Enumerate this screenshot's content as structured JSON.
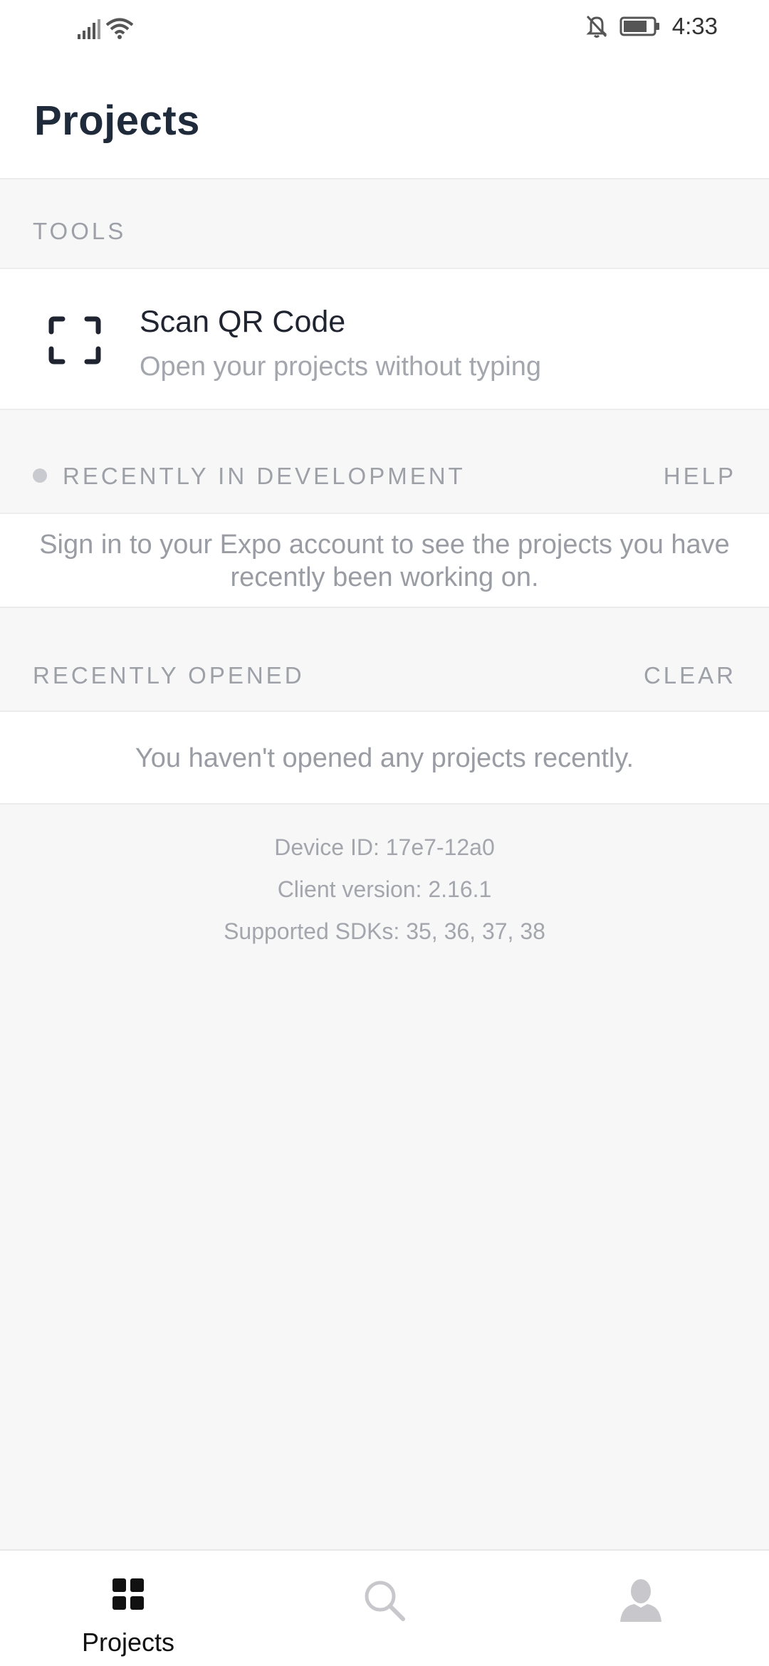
{
  "status_bar": {
    "time": "4:33",
    "icons": [
      "signal-icon",
      "wifi-icon",
      "bell-off-icon",
      "battery-icon"
    ]
  },
  "header": {
    "title": "Projects"
  },
  "tools": {
    "label": "TOOLS",
    "scan": {
      "title": "Scan QR Code",
      "subtitle": "Open your projects without typing",
      "icon": "qr-scan-icon"
    }
  },
  "recent_dev": {
    "label": "RECENTLY IN DEVELOPMENT",
    "action": "HELP",
    "message": "Sign in to your Expo account to see the projects you have recently been working on."
  },
  "recent_opened": {
    "label": "RECENTLY OPENED",
    "action": "CLEAR",
    "message": "You haven't opened any projects recently."
  },
  "device": {
    "device_id": "Device ID: 17e7-12a0",
    "client_version": "Client version: 2.16.1",
    "sdks": "Supported SDKs: 35, 36, 37, 38"
  },
  "tab_bar": {
    "projects_label": "Projects",
    "active_color": "#111111",
    "inactive_color": "#c8c8cc"
  }
}
